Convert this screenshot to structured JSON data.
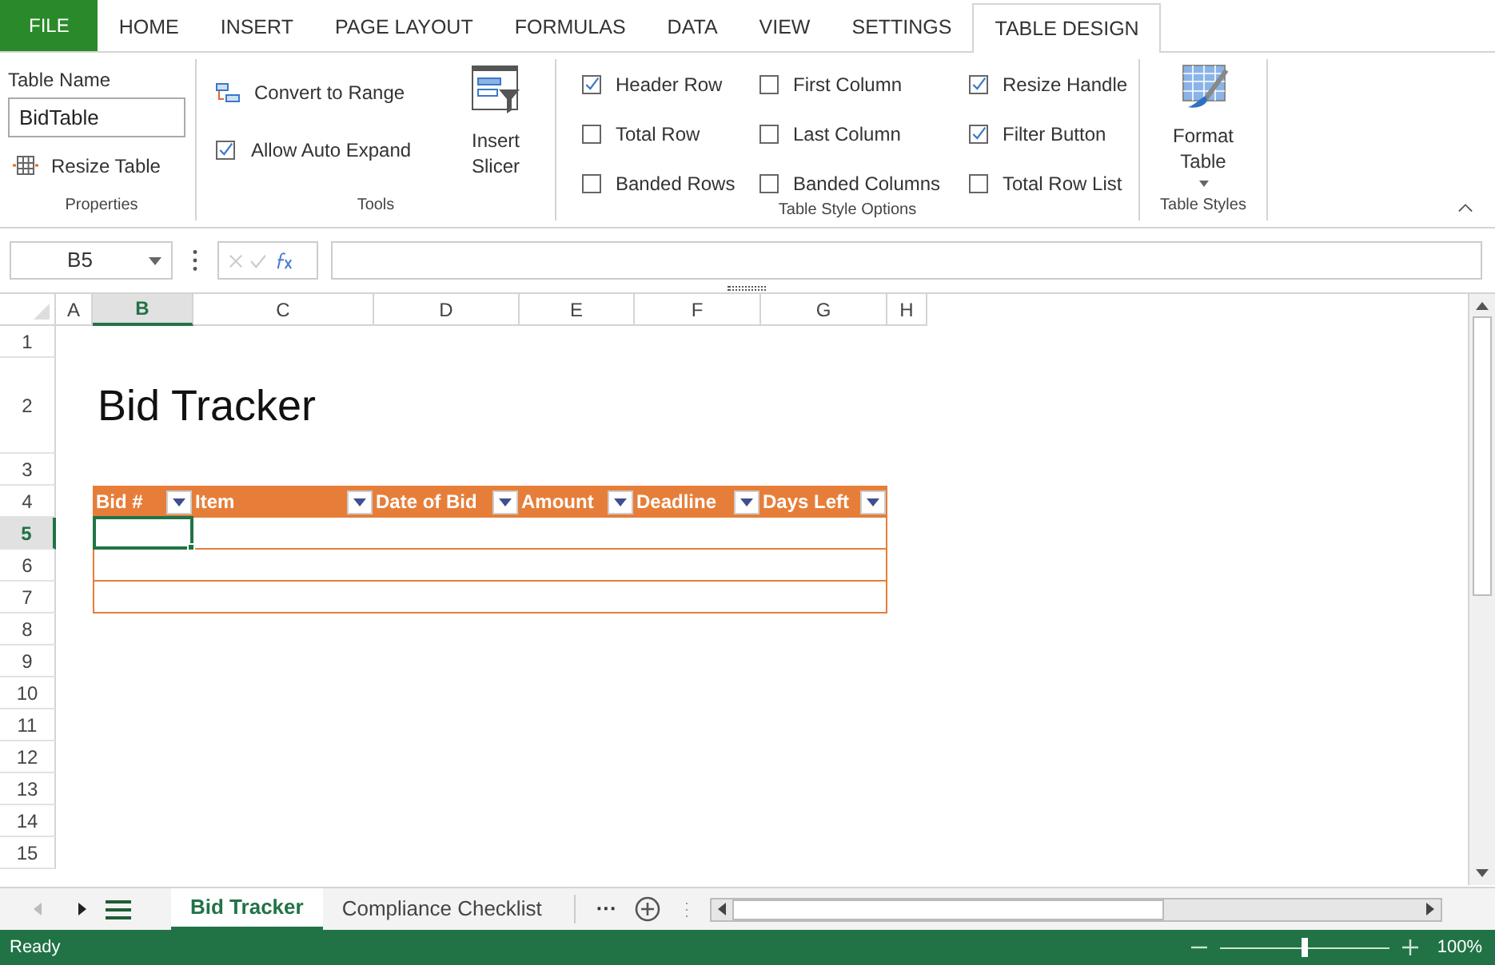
{
  "ribbon_tabs": [
    {
      "label": "FILE",
      "kind": "file",
      "selected": false
    },
    {
      "label": "HOME",
      "kind": "tab",
      "selected": false
    },
    {
      "label": "INSERT",
      "kind": "tab",
      "selected": false
    },
    {
      "label": "PAGE LAYOUT",
      "kind": "tab",
      "selected": false
    },
    {
      "label": "FORMULAS",
      "kind": "tab",
      "selected": false
    },
    {
      "label": "DATA",
      "kind": "tab",
      "selected": false
    },
    {
      "label": "VIEW",
      "kind": "tab",
      "selected": false
    },
    {
      "label": "SETTINGS",
      "kind": "tab",
      "selected": false
    },
    {
      "label": "TABLE DESIGN",
      "kind": "tab",
      "selected": true
    }
  ],
  "properties": {
    "label": "Table Name",
    "value": "BidTable",
    "resize_button": "Resize Table",
    "group_label": "Properties"
  },
  "tools": {
    "convert_button": "Convert to Range",
    "auto_expand": {
      "label": "Allow Auto Expand",
      "checked": true
    },
    "slicer_button": "Insert Slicer",
    "group_label": "Tools"
  },
  "table_style_options": {
    "options": [
      {
        "label": "Header Row",
        "checked": true
      },
      {
        "label": "Total Row",
        "checked": false
      },
      {
        "label": "Banded Rows",
        "checked": false
      },
      {
        "label": "First Column",
        "checked": false
      },
      {
        "label": "Last Column",
        "checked": false
      },
      {
        "label": "Banded Columns",
        "checked": false
      },
      {
        "label": "Resize Handle",
        "checked": true
      },
      {
        "label": "Filter Button",
        "checked": true
      },
      {
        "label": "Total Row List",
        "checked": false
      }
    ],
    "group_label": "Table Style Options"
  },
  "table_styles": {
    "button": "Format Table",
    "group_label": "Table Styles"
  },
  "name_box": "B5",
  "columns": [
    {
      "label": "A",
      "selected": false
    },
    {
      "label": "B",
      "selected": true
    },
    {
      "label": "C",
      "selected": false
    },
    {
      "label": "D",
      "selected": false
    },
    {
      "label": "E",
      "selected": false
    },
    {
      "label": "F",
      "selected": false
    },
    {
      "label": "G",
      "selected": false
    },
    {
      "label": "H",
      "selected": false
    }
  ],
  "rows": [
    {
      "label": "1",
      "kind": "normal",
      "selected": false
    },
    {
      "label": "2",
      "kind": "title",
      "selected": false
    },
    {
      "label": "3",
      "kind": "normal",
      "selected": false
    },
    {
      "label": "4",
      "kind": "header",
      "selected": false
    },
    {
      "label": "5",
      "kind": "data",
      "selected": true
    },
    {
      "label": "6",
      "kind": "data",
      "selected": false
    },
    {
      "label": "7",
      "kind": "data",
      "selected": false
    },
    {
      "label": "8",
      "kind": "normal",
      "selected": false
    },
    {
      "label": "9",
      "kind": "normal",
      "selected": false
    },
    {
      "label": "10",
      "kind": "normal",
      "selected": false
    },
    {
      "label": "11",
      "kind": "normal",
      "selected": false
    },
    {
      "label": "12",
      "kind": "normal",
      "selected": false
    },
    {
      "label": "13",
      "kind": "normal",
      "selected": false
    },
    {
      "label": "14",
      "kind": "normal",
      "selected": false
    },
    {
      "label": "15",
      "kind": "normal",
      "selected": false
    }
  ],
  "sheet_title": "Bid Tracker",
  "table_headers": [
    "Bid #",
    "Item",
    "Date of Bid",
    "Amount",
    "Deadline",
    "Days Left"
  ],
  "sheet_tabs": [
    {
      "label": "Bid Tracker",
      "selected": true
    },
    {
      "label": "Compliance Checklist",
      "selected": false
    }
  ],
  "more_sheets": "···",
  "status": "Ready",
  "zoom": {
    "level": 0.5,
    "reading": "100%"
  }
}
